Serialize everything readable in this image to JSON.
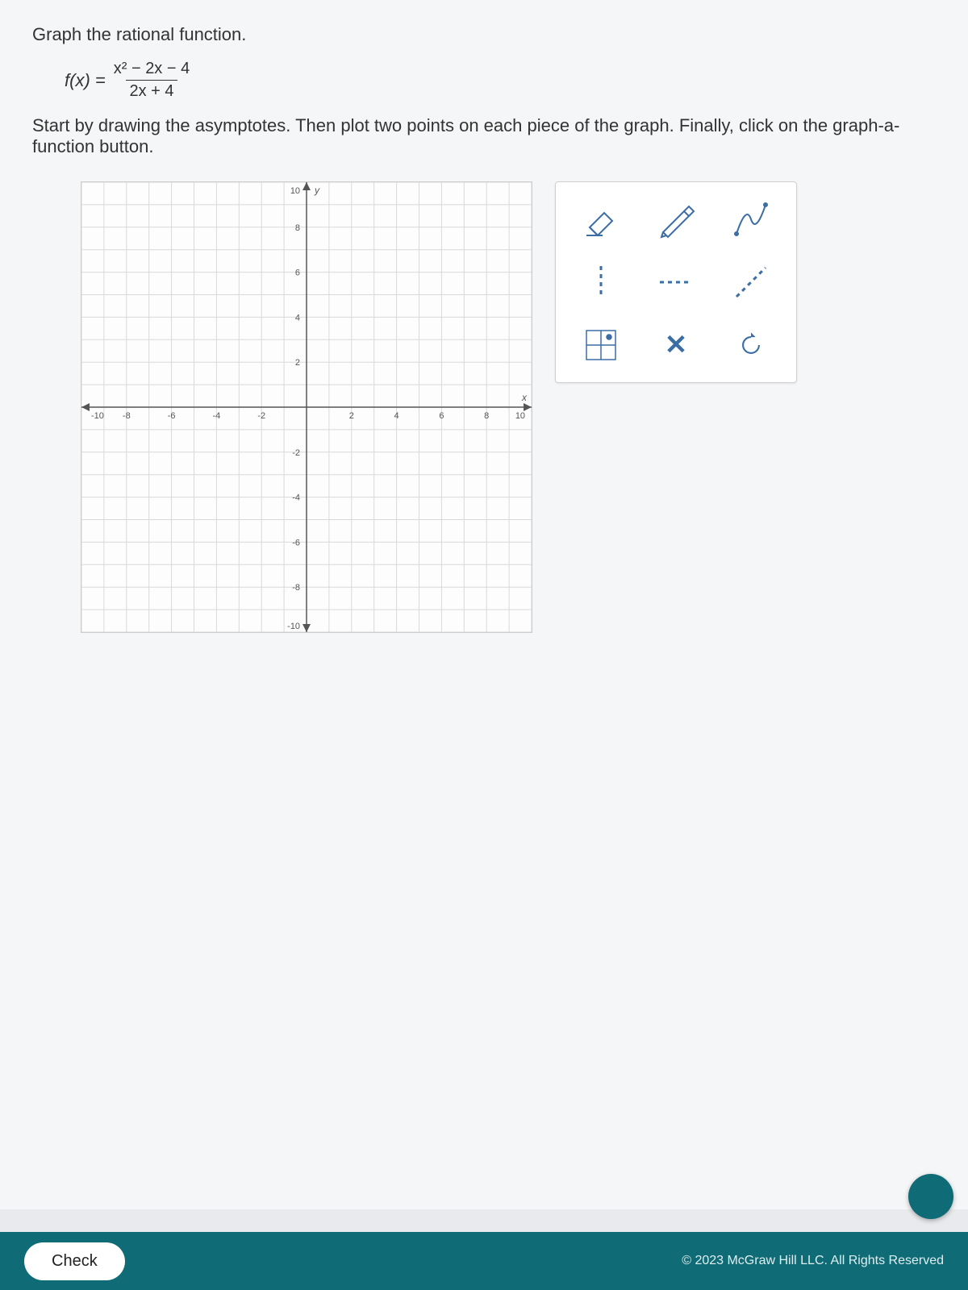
{
  "prompt": {
    "line1": "Graph the rational function.",
    "fx_lhs": "f(x) =",
    "numerator": "x² − 2x − 4",
    "denominator": "2x + 4",
    "line2": "Start by drawing the asymptotes. Then plot two points on each piece of the graph. Finally, click on the graph-a-function button."
  },
  "chart_data": {
    "type": "scatter",
    "title": "",
    "xlabel": "x",
    "ylabel": "y",
    "xlim": [
      -10,
      10
    ],
    "ylim": [
      -10,
      10
    ],
    "x_ticks": [
      -10,
      -8,
      -6,
      -4,
      -2,
      2,
      4,
      6,
      8,
      10
    ],
    "y_ticks": [
      -10,
      -8,
      -6,
      -4,
      -2,
      2,
      4,
      6,
      8,
      10
    ],
    "series": []
  },
  "tools": {
    "eraser": "eraser-tool",
    "pencil": "pencil-tool",
    "curve": "curve-tool",
    "dashed_v": "vertical-asymptote-tool",
    "dashed_h": "horizontal-asymptote-tool",
    "dashed_oblique": "oblique-asymptote-tool",
    "point_grid": "point-grid-tool",
    "clear": "clear-tool",
    "reset": "reset-tool"
  },
  "bottom": {
    "check_label": "Check",
    "copyright": "© 2023 McGraw Hill LLC. All Rights Reserved"
  }
}
